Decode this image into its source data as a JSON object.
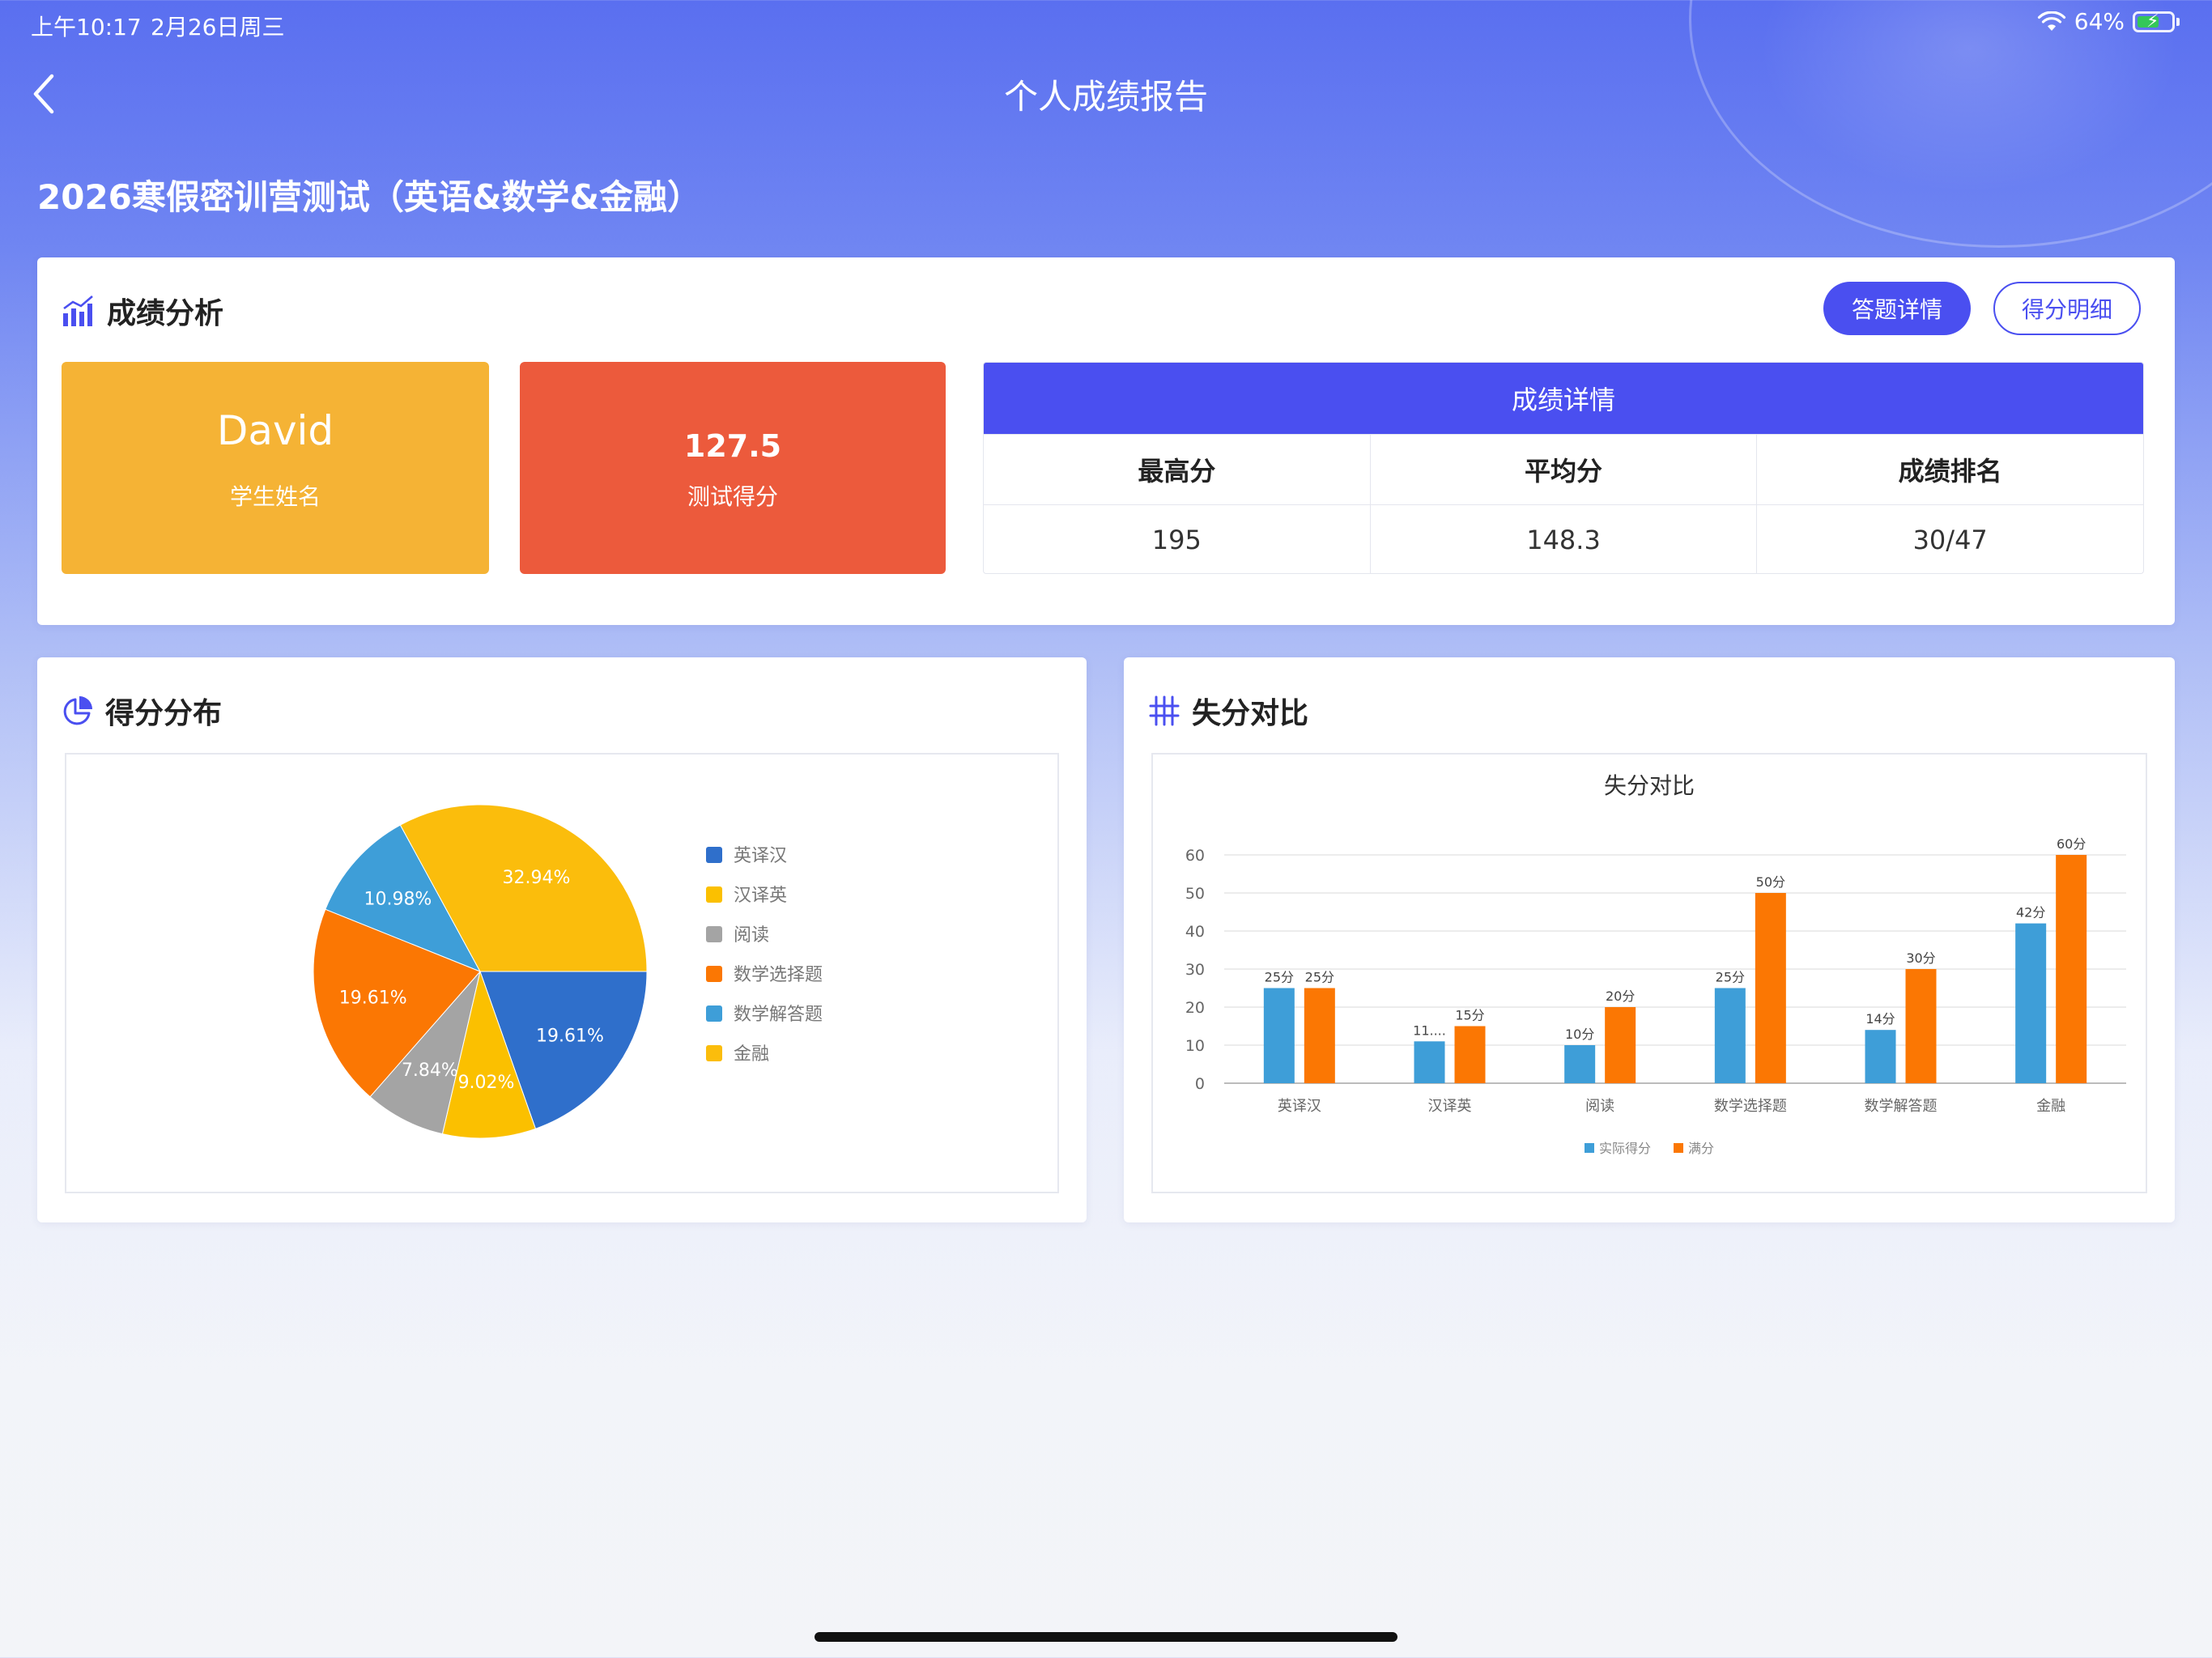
{
  "status": {
    "time": "上午10:17",
    "date": "2月26日周三",
    "battery": "64%",
    "battery_level": 0.64
  },
  "nav": {
    "title": "个人成绩报告"
  },
  "exam": {
    "title": "2026寒假密训营测试（英语&数学&金融）"
  },
  "analysis": {
    "title": "成绩分析",
    "btn_answers": "答题详情",
    "btn_scores": "得分明细",
    "student_name": "David",
    "student_label": "学生姓名",
    "test_score": "127.5",
    "test_label": "测试得分",
    "detail_title": "成绩详情",
    "headers": [
      "最高分",
      "平均分",
      "成绩排名"
    ],
    "values": [
      "195",
      "148.3",
      "30/47"
    ]
  },
  "distribution": {
    "title": "得分分布"
  },
  "comparison": {
    "title": "失分对比"
  },
  "colors": {
    "accent": "#4a4ff0",
    "name_box": "#f5b335",
    "score_box": "#ec5a3c"
  },
  "chart_data": [
    {
      "type": "pie",
      "title": "",
      "labels": [
        "英译汉",
        "汉译英",
        "阅读",
        "数学选择题",
        "数学解答题",
        "金融"
      ],
      "values": [
        19.61,
        9.02,
        7.84,
        19.61,
        10.98,
        32.94
      ],
      "value_labels": [
        "19.61%",
        "9.02%",
        "7.84%",
        "19.61%",
        "10.98%",
        "32.94%"
      ],
      "colors": [
        "#2f6fcb",
        "#fbc000",
        "#a4a4a4",
        "#fb7703",
        "#3e9ed8",
        "#fbbd0c"
      ],
      "legend_position": "right"
    },
    {
      "type": "bar",
      "title": "失分对比",
      "categories": [
        "英译汉",
        "汉译英",
        "阅读",
        "数学选择题",
        "数学解答题",
        "金融"
      ],
      "series": [
        {
          "name": "实际得分",
          "values": [
            25,
            11,
            10,
            25,
            14,
            42
          ],
          "labels": [
            "25分",
            "11....",
            "10分",
            "25分",
            "14分",
            "42分"
          ],
          "color": "#3e9ed8"
        },
        {
          "name": "满分",
          "values": [
            25,
            15,
            20,
            50,
            30,
            60
          ],
          "labels": [
            "25分",
            "15分",
            "20分",
            "50分",
            "30分",
            "60分"
          ],
          "color": "#fb7703"
        }
      ],
      "ylim": [
        0,
        60
      ],
      "yticks": [
        "0",
        "10",
        "20",
        "30",
        "40",
        "50",
        "60"
      ],
      "grid": true,
      "legend_position": "bottom"
    }
  ]
}
